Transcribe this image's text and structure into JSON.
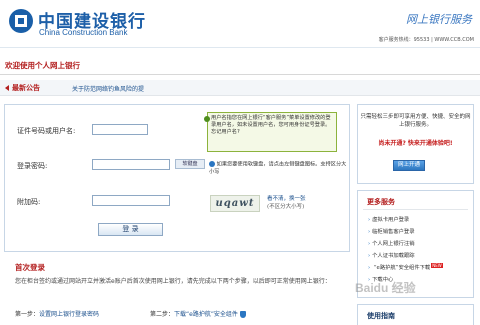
{
  "header": {
    "logo_cn": "中国建设银行",
    "logo_en": "China Construction Bank",
    "service_title": "网上银行服务",
    "hotline": "客户服务热线：95533 | WWW.CCB.COM"
  },
  "welcome": "欢迎使用个人网上银行",
  "notice": {
    "label": "最新公告",
    "link": "关于防范网络钓鱼风险的提"
  },
  "login": {
    "username_label": "证件号码或用户名:",
    "password_label": "登录密码:",
    "captcha_label": "附加码:",
    "keyboard_btn": "软键盘",
    "hint": "用户名指您在网上银行“客户服务”菜单设置修改的登录用户名，如未设置用户名，您可用身份证号登录。忘记用户名?",
    "pwd_tip": "如果您要使用软键盘，请点击左侧键盘图标。支持区分大小写",
    "captcha_text": "uqawt",
    "captcha_refresh": "看不清，换一张",
    "captcha_sub": "(不区分大小写)",
    "submit": "登 录"
  },
  "first_login": {
    "title": "首次登录",
    "desc": "您在柜台签约或通过网站开立并激活e账户后首次使用网上银行，请先完成以下两个步骤，以后即可正常使用网上银行：",
    "step1_prefix": "第一步：",
    "step1_link": "设置网上银行登录密码",
    "step2_prefix": "第二步：",
    "step2_link": "下载“e路护航”安全组件"
  },
  "open_panel": {
    "line1": "只需轻松三步即可享用方便、快捷、安全的网上银行服务。",
    "link": "尚未开通? 快来开通体验吧!",
    "button": "网上开通"
  },
  "more_panel": {
    "title": "更多服务",
    "items": [
      "虚拟卡用户登录",
      "临柜销售客户登录",
      "个人网上银行注销",
      "个人证书加载跟踪",
      "“e路护航”安全组件下载",
      "下载中心"
    ],
    "new_badge": "NEW"
  },
  "guide_panel": {
    "title": "使用指南"
  },
  "watermark": "Baidu 经验"
}
